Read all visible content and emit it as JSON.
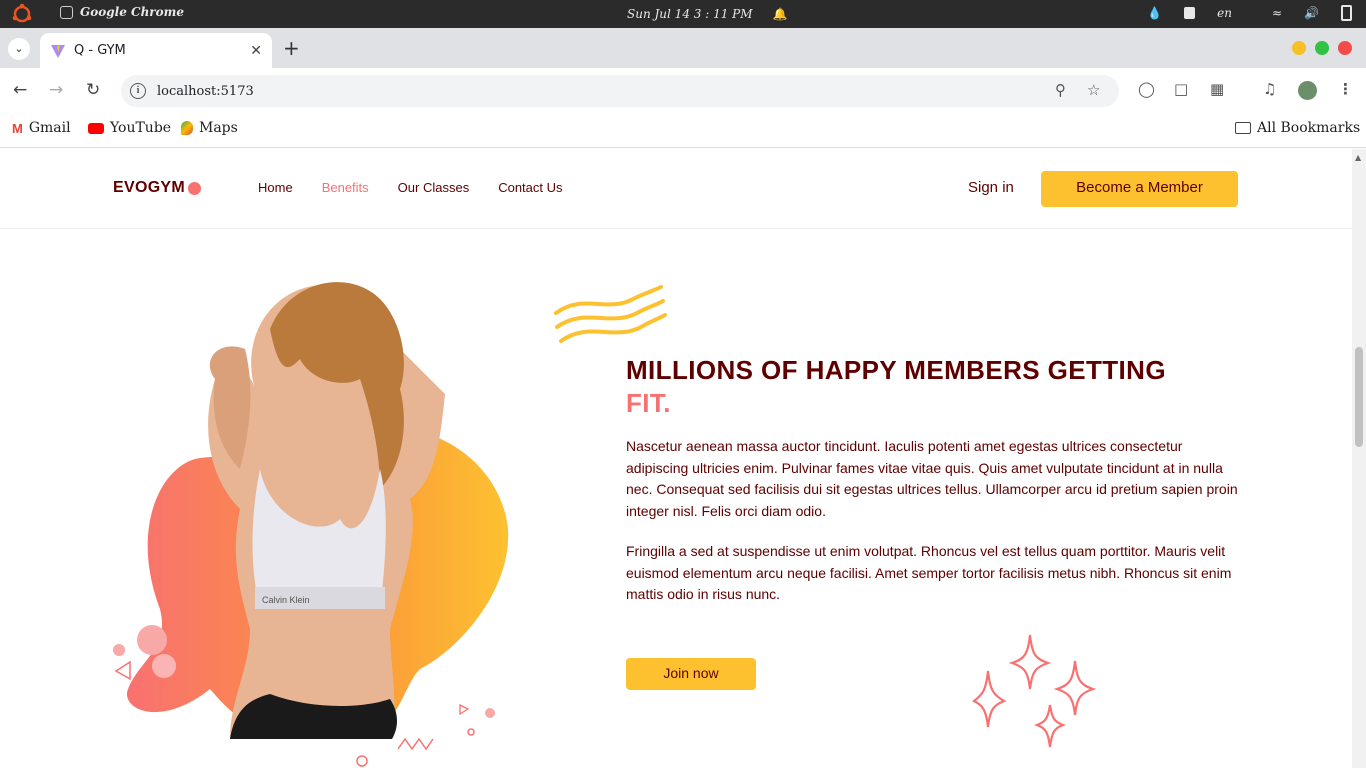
{
  "os": {
    "app_name": "Google Chrome",
    "clock": "Sun Jul 14  3 : 11 PM",
    "lang": "en"
  },
  "browser": {
    "tab_title": "Q - GYM",
    "url": "localhost:5173",
    "bookmarks": [
      "Gmail",
      "YouTube",
      "Maps"
    ],
    "all_bookmarks": "All Bookmarks"
  },
  "site": {
    "logo": "EVOGYM",
    "nav": [
      "Home",
      "Benefits",
      "Our Classes",
      "Contact Us"
    ],
    "active_nav": "Benefits",
    "sign_in": "Sign in",
    "cta": "Become a Member"
  },
  "section": {
    "heading_main": "MILLIONS OF HAPPY MEMBERS GETTING",
    "heading_accent": "FIT.",
    "paragraph_1": "Nascetur aenean massa auctor tincidunt. Iaculis potenti amet egestas ultrices consectetur adipiscing ultricies enim. Pulvinar fames vitae vitae quis. Quis amet vulputate tincidunt at in nulla nec. Consequat sed facilisis dui sit egestas ultrices tellus. Ullamcorper arcu id pretium sapien proin integer nisl. Felis orci diam odio.",
    "paragraph_2": "Fringilla a sed at suspendisse ut enim volutpat. Rhoncus vel est tellus quam porttitor. Mauris velit euismod elementum arcu neque facilisi. Amet semper tortor facilisis metus nibh. Rhoncus sit enim mattis odio in risus nunc.",
    "join_button": "Join now",
    "image_text": "Calvin Klein"
  },
  "colors": {
    "primary": "#5e0000",
    "accent": "#f87171",
    "yellow": "#fdc130"
  }
}
